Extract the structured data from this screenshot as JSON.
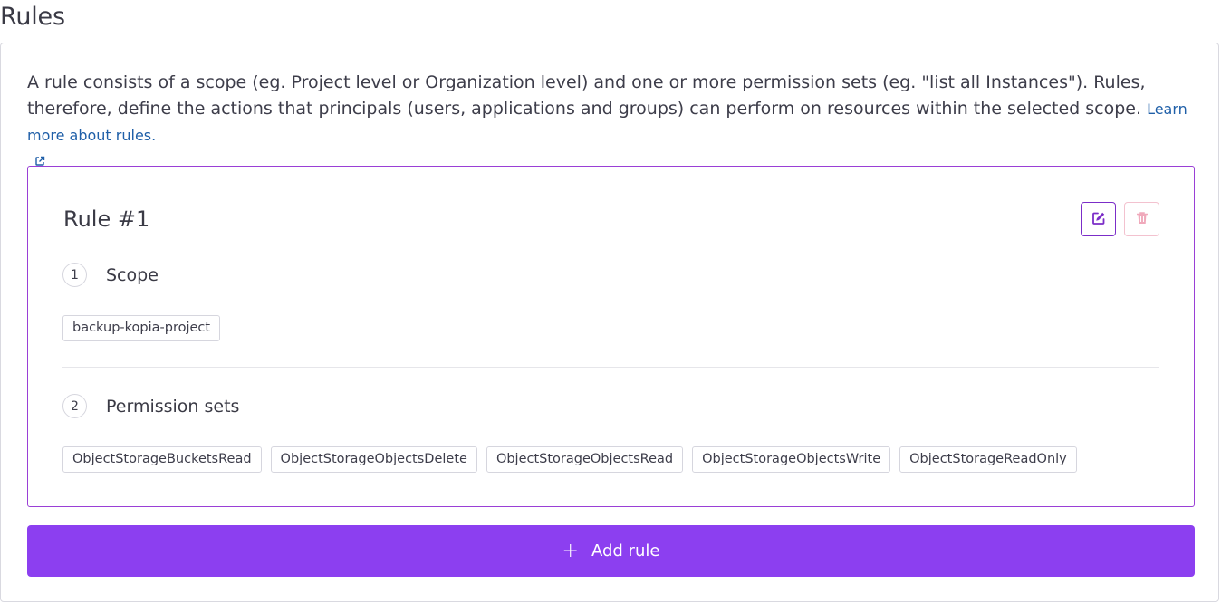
{
  "page": {
    "title": "Rules"
  },
  "description": {
    "text": "A rule consists of a scope (eg. Project level or Organization level) and one or more permission sets (eg. \"list all Instances\"). Rules, therefore, define the actions that principals (users, applications and groups) can perform on resources within the selected scope. ",
    "link_text": "Learn more about rules."
  },
  "rule": {
    "title": "Rule #1",
    "scope": {
      "number": "1",
      "label": "Scope",
      "tags": [
        "backup-kopia-project"
      ]
    },
    "permission_sets": {
      "number": "2",
      "label": "Permission sets",
      "tags": [
        "ObjectStorageBucketsRead",
        "ObjectStorageObjectsDelete",
        "ObjectStorageObjectsRead",
        "ObjectStorageObjectsWrite",
        "ObjectStorageReadOnly"
      ]
    }
  },
  "actions": {
    "add_rule_label": "Add rule",
    "add_rule_icon": "+"
  },
  "icons": {
    "edit": "edit-icon",
    "delete": "trash-icon",
    "external_link": "external-link-icon"
  },
  "colors": {
    "primary": "#8c3ff0",
    "card_border": "#9a3fd6",
    "link": "#1f5fa8",
    "danger_light": "#f3c2cf"
  }
}
